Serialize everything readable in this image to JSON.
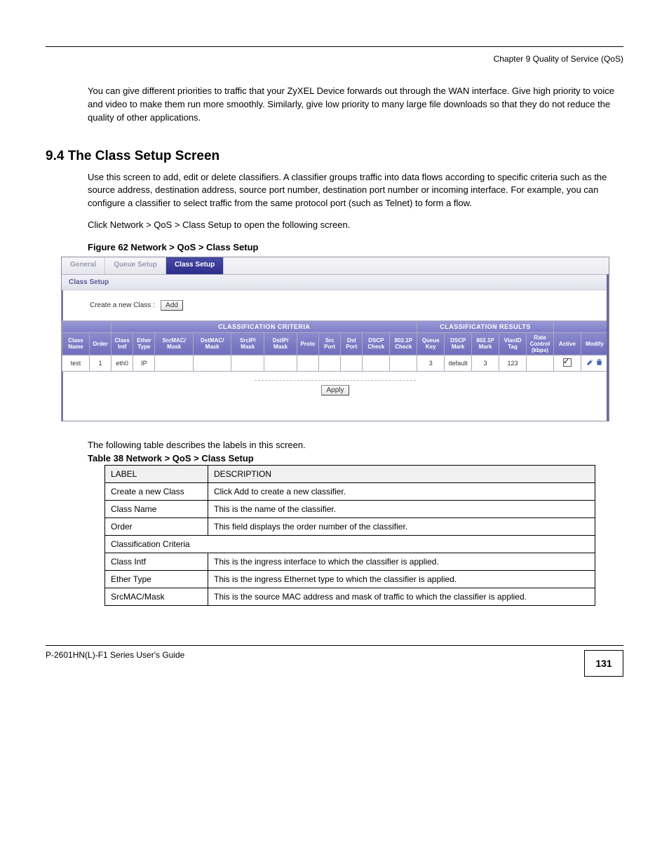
{
  "chapter_line": "Chapter 9 Quality of Service (QoS)",
  "intro_paragraphs": [
    "You can give different priorities to traffic that your ZyXEL Device forwards out through the WAN interface. Give high priority to voice and video to make them run more smoothly. Similarly, give low priority to many large file downloads so that they do not reduce the quality of other applications."
  ],
  "section_heading": "9.4  The Class Setup Screen",
  "section_paragraphs": [
    "Use this screen to add, edit or delete classifiers. A classifier groups traffic into data flows according to specific criteria such as the source address, destination address, source port number, destination port number or incoming interface. For example, you can configure a classifier to select traffic from the same protocol port (such as Telnet) to form a flow.",
    "Click Network > QoS > Class Setup to open the following screen."
  ],
  "figure_caption": "Figure 62   Network > QoS > Class Setup",
  "shot": {
    "tabs": [
      "General",
      "Queue Setup",
      "Class Setup"
    ],
    "active_tab_index": 2,
    "subhead": "Class Setup",
    "create_label": "Create a new Class :",
    "add_btn": "Add",
    "group_headers": [
      "",
      "CLASSIFICATION CRITERIA",
      "CLASSIFICATION RESULTS",
      ""
    ],
    "columns": [
      "Class Name",
      "Order",
      "Class Intf",
      "Ether Type",
      "SrcMAC/ Mask",
      "DstMAC/ Mask",
      "SrcIP/ Mask",
      "DstIP/ Mask",
      "Proto",
      "Src Port",
      "Dst Port",
      "DSCP Check",
      "802.1P Check",
      "Queue Key",
      "DSCP Mark",
      "802.1P Mark",
      "VlanID Tag",
      "Rate Control (kbps)",
      "Active",
      "Modify"
    ],
    "row": {
      "class_name": "test",
      "order": "1",
      "class_intf": "eth0",
      "ether_type": "IP",
      "srcmac": "",
      "dstmac": "",
      "srcip": "",
      "dstip": "",
      "proto": "",
      "srcport": "",
      "dstport": "",
      "dscp_check": "",
      "p8021_check": "",
      "queue_key": "3",
      "dscp_mark": "default",
      "p8021_mark": "3",
      "vlan_tag": "123",
      "rate": "",
      "active_checked": true
    },
    "apply_btn": "Apply"
  },
  "table_intro": "The following table describes the labels in this screen.",
  "doc_table_caption": "Table 38   Network > QoS > Class Setup",
  "doc_table_head": [
    "LABEL",
    "DESCRIPTION"
  ],
  "doc_table_rows": [
    [
      "Create a new Class",
      "Click Add to create a new classifier."
    ],
    [
      "Class Name",
      "This is the name of the classifier."
    ],
    [
      "Order",
      "This field displays the order number of the classifier."
    ],
    [
      "Classification Criteria",
      ""
    ],
    [
      "Class Intf",
      "This is the ingress interface to which the classifier is applied."
    ],
    [
      "Ether Type",
      "This is the ingress Ethernet type to which the classifier is applied."
    ],
    [
      "SrcMAC/Mask",
      "This is the source MAC address and mask of traffic to which the classifier is applied."
    ]
  ],
  "footer_left": "P-2601HN(L)-F1 Series User's Guide",
  "page_number": "131"
}
